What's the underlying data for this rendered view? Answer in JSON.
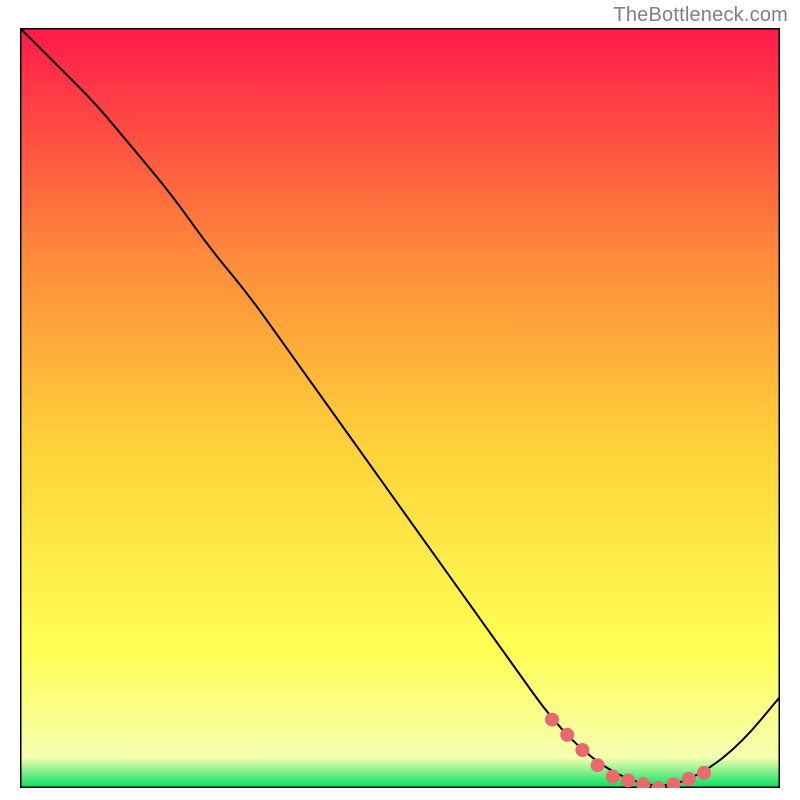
{
  "watermark": "TheBottleneck.com",
  "chart_data": {
    "type": "line",
    "title": "",
    "xlabel": "",
    "ylabel": "",
    "xlim": [
      0,
      100
    ],
    "ylim": [
      0,
      100
    ],
    "grid": false,
    "legend": false,
    "background_gradient": {
      "top": "#ff1a4a",
      "mid_upper": "#ff8a3a",
      "mid": "#ffd23a",
      "mid_lower": "#ffff55",
      "bottom": "#00e060",
      "green_band_top_fraction": 0.965
    },
    "series": [
      {
        "name": "bottleneck-curve",
        "color": "#000000",
        "stroke_width": 2,
        "x": [
          0,
          5,
          10,
          15,
          20,
          25,
          30,
          35,
          40,
          45,
          50,
          55,
          60,
          65,
          70,
          75,
          80,
          85,
          90,
          95,
          100
        ],
        "y": [
          100,
          95,
          90,
          84,
          78,
          71,
          65,
          58,
          51,
          44,
          37,
          30,
          23,
          16,
          9,
          4,
          1,
          0,
          2,
          6,
          12
        ]
      },
      {
        "name": "highlight-markers",
        "color": "#e86a6e",
        "marker_radius": 7,
        "x": [
          70,
          72,
          74,
          76,
          78,
          80,
          82,
          84,
          86,
          88,
          90
        ],
        "y": [
          9,
          7,
          5,
          3,
          1.5,
          1,
          0.5,
          0,
          0.5,
          1.2,
          2
        ]
      }
    ]
  }
}
